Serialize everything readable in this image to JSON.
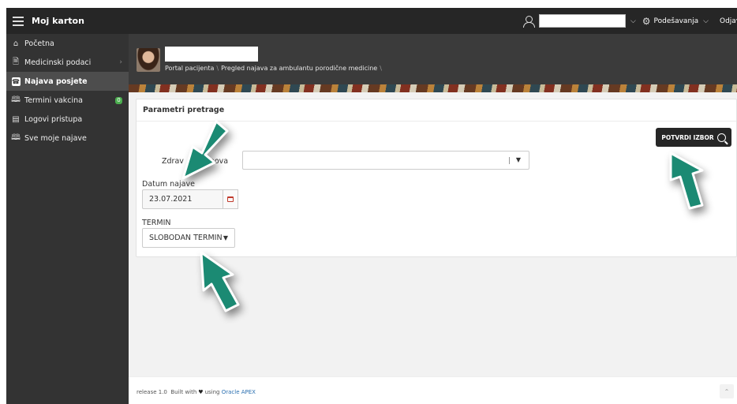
{
  "header": {
    "app_title": "Moj karton",
    "settings_label": "Podešavanja",
    "logout_label": "Odjava",
    "icons": {
      "menu": "hamburger-icon",
      "user": "user-icon",
      "settings": "gear-icon",
      "chevron": "chevron-down-icon"
    }
  },
  "sidebar": {
    "items": [
      {
        "label": "Početna",
        "icon": "home-icon"
      },
      {
        "label": "Medicinski podaci",
        "icon": "document-icon",
        "chevron": "›"
      },
      {
        "label": "Najava posjete",
        "icon": "phone-icon",
        "active": true
      },
      {
        "label": "Termini vakcina",
        "icon": "book-icon",
        "badge": "0"
      },
      {
        "label": "Logovi pristupa",
        "icon": "archive-icon"
      },
      {
        "label": "Sve moje najave",
        "icon": "book-icon"
      }
    ]
  },
  "hero": {
    "breadcrumb": [
      "Portal pacijenta",
      "Pregled najava za ambulantu porodične medicine"
    ]
  },
  "region": {
    "title": "Parametri pretrage",
    "confirm_button": "POTVRDI IZBOR",
    "zdrav_label_left": "Zdrav",
    "zdrav_label_right": "anova",
    "datum_label": "Datum najave",
    "datum_value": "23.07.2021",
    "termin_label": "TERMIN",
    "termin_value": "SLOBODAN TERMIN"
  },
  "footer": {
    "release": "release 1.0",
    "built_with": "Built with",
    "using": "using",
    "apex_link": "Oracle APEX"
  },
  "colors": {
    "topbar": "#262626",
    "sidebar": "#333333",
    "sidebar_active": "#4d4d4d",
    "badge": "#4caf50",
    "annotation_arrow": "#1b8a73",
    "link": "#2a6fb0"
  }
}
